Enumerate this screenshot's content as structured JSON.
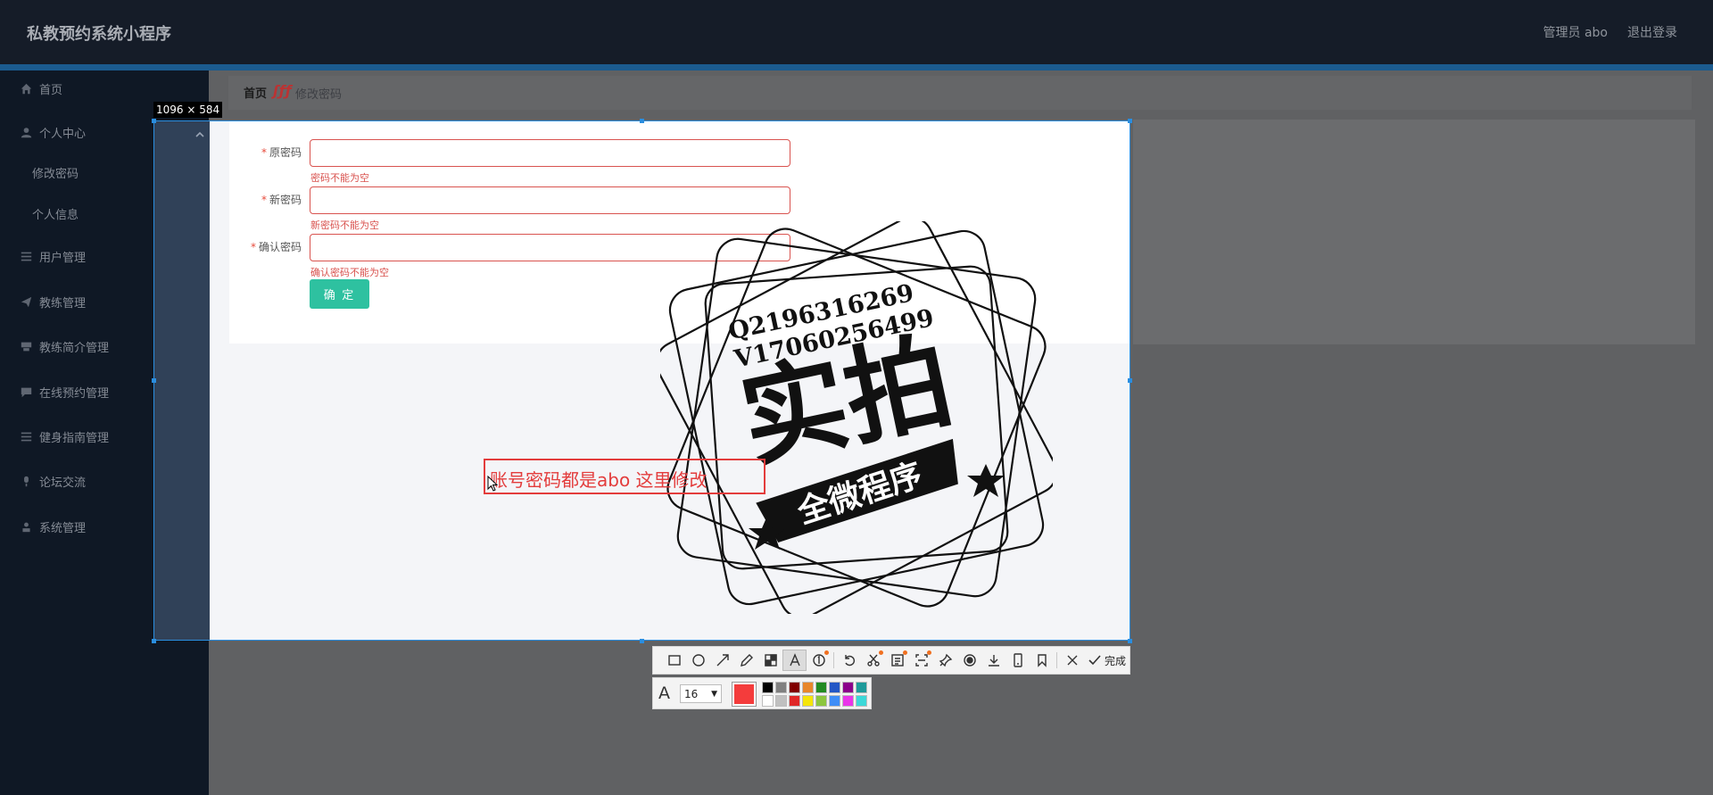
{
  "header": {
    "app_title": "私教预约系统小程序",
    "admin_label": "管理员 abo",
    "logout_label": "退出登录"
  },
  "sidebar": {
    "items": [
      {
        "label": "首页",
        "icon": "home-icon"
      },
      {
        "label": "个人中心",
        "icon": "user-icon"
      },
      {
        "label": "用户管理",
        "icon": "list-icon"
      },
      {
        "label": "教练管理",
        "icon": "send-icon"
      },
      {
        "label": "教练简介管理",
        "icon": "card-icon"
      },
      {
        "label": "在线预约管理",
        "icon": "chat-icon"
      },
      {
        "label": "健身指南管理",
        "icon": "list-icon"
      },
      {
        "label": "论坛交流",
        "icon": "mic-icon"
      },
      {
        "label": "系统管理",
        "icon": "person-icon"
      }
    ],
    "subitems": [
      {
        "label": "修改密码"
      },
      {
        "label": "个人信息"
      }
    ]
  },
  "breadcrumb": {
    "home": "首页",
    "separator": "ʃƒƒ",
    "current": "修改密码"
  },
  "screenshot": {
    "size_label": "1096 × 584"
  },
  "form": {
    "fields": [
      {
        "label": "原密码",
        "required": "*",
        "error": "密码不能为空",
        "value": ""
      },
      {
        "label": "新密码",
        "required": "*",
        "error": "新密码不能为空",
        "value": ""
      },
      {
        "label": "确认密码",
        "required": "*",
        "error": "确认密码不能为空",
        "value": ""
      }
    ],
    "submit_label": "确 定"
  },
  "annotation": {
    "text": "账号密码都是abo 这里修改",
    "color": "#e33c3c"
  },
  "stamp": {
    "line1": "Q2196316269",
    "line2": "V17060256499",
    "main": "实拍",
    "banner": "全微程序"
  },
  "toolbar": {
    "tools": [
      "rectangle-icon",
      "ellipse-icon",
      "arrow-icon",
      "pen-icon",
      "mosaic-icon",
      "text-icon",
      "number-icon",
      "undo-icon",
      "crop-icon",
      "ocr-icon",
      "scan-icon",
      "pin-icon",
      "record-icon",
      "download-icon",
      "phone-icon",
      "bookmark-icon",
      "close-icon"
    ],
    "done_label": "完成"
  },
  "text_options": {
    "font_size": "16",
    "current_color": "#f43c3c",
    "palette": [
      "#000000",
      "#808080",
      "#800000",
      "#e8872b",
      "#228b22",
      "#2457c5",
      "#8b008b",
      "#1e9a9a",
      "#ffffff",
      "#c0c0c0",
      "#e02828",
      "#f5e50a",
      "#8cc63e",
      "#3f8ef7",
      "#e935e9",
      "#3cd8d8"
    ]
  }
}
